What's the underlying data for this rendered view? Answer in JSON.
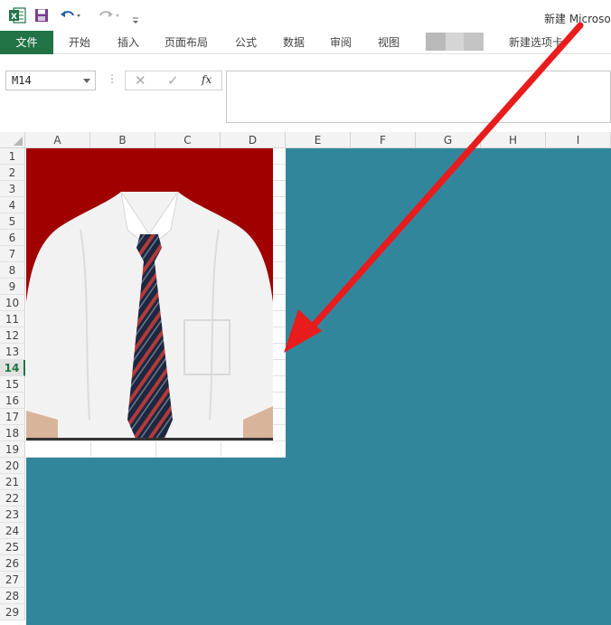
{
  "app": {
    "title": "新建 Microso",
    "name_box": "M14"
  },
  "qat": {
    "excel_icon": "excel-logo-icon",
    "save_icon": "save-icon",
    "undo_icon": "undo-icon",
    "redo_icon": "redo-icon",
    "customize_icon": "customize-qat-icon"
  },
  "tabs": [
    {
      "label": "文件"
    },
    {
      "label": "开始"
    },
    {
      "label": "插入"
    },
    {
      "label": "页面布局"
    },
    {
      "label": "公式"
    },
    {
      "label": "数据"
    },
    {
      "label": "审阅"
    },
    {
      "label": "视图"
    },
    {
      "label": "新建选项卡"
    }
  ],
  "formula_bar": {
    "dots": "⋮",
    "cancel": "✕",
    "enter": "✓",
    "fx": "fx",
    "value": ""
  },
  "columns": [
    "A",
    "B",
    "C",
    "D",
    "E",
    "F",
    "G",
    "H",
    "I"
  ],
  "rows": [
    "1",
    "2",
    "3",
    "4",
    "5",
    "6",
    "7",
    "8",
    "9",
    "10",
    "11",
    "12",
    "13",
    "14",
    "15",
    "16",
    "17",
    "18",
    "19",
    "20",
    "21",
    "22",
    "23",
    "24",
    "25",
    "26",
    "27",
    "28",
    "29"
  ],
  "active_row": "14",
  "colors": {
    "excel_green": "#217346",
    "teal_fill": "#32869c",
    "photo_background": "#a00000",
    "arrow": "#e81c1c"
  }
}
